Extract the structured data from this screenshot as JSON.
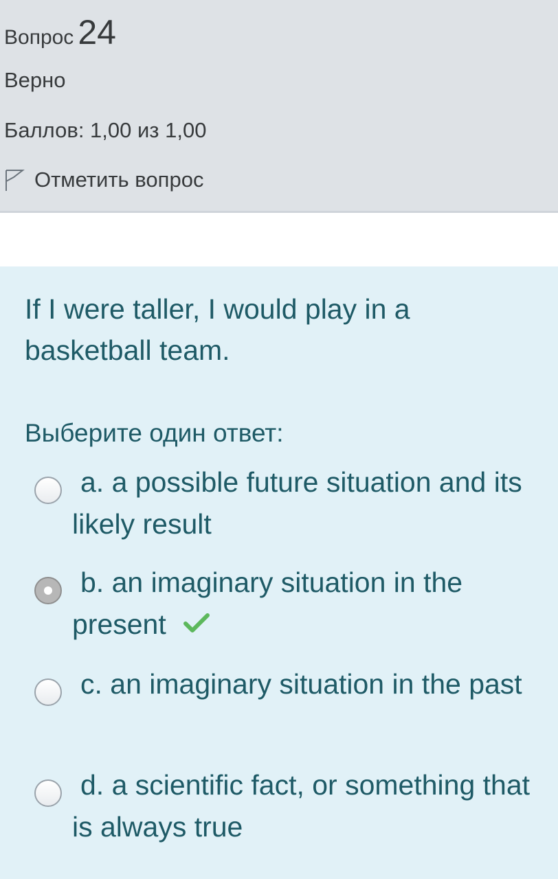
{
  "info": {
    "question_label": "Вопрос",
    "question_number": "24",
    "state": "Верно",
    "grade": "Баллов: 1,00 из 1,00",
    "flag_label": "Отметить вопрос",
    "flag_icon": "flag-outline-icon"
  },
  "question": {
    "text": "If I were taller, I would play in a basketball team.",
    "prompt": "Выберите один ответ:",
    "answers": [
      {
        "label": "a. a possible future situation and its likely result",
        "selected": false,
        "correct": false
      },
      {
        "label": "b. an imaginary situation in the present",
        "selected": true,
        "correct": true,
        "mark_icon": "check-icon"
      },
      {
        "label": "c. an imaginary situation in the past",
        "selected": false,
        "correct": false
      },
      {
        "label": "d. a scientific fact, or something that is always true",
        "selected": false,
        "correct": false
      }
    ]
  },
  "colors": {
    "info_background": "#dee2e6",
    "question_background": "#e1f1f7",
    "question_text": "#1e5a66",
    "correct_mark": "#5cb85c"
  }
}
